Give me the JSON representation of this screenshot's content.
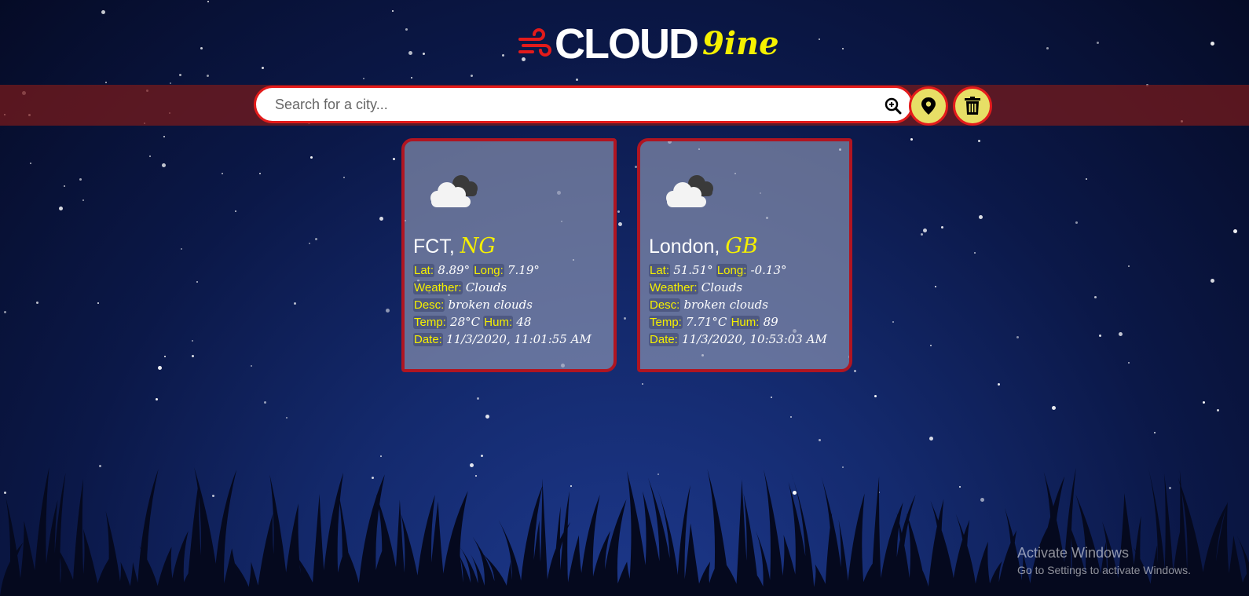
{
  "logo": {
    "word1": "CLOUD",
    "word2": "9ine",
    "icon": "wind-icon"
  },
  "search": {
    "placeholder": "Search for a city...",
    "button_icon": "search-zoom-icon"
  },
  "actions": {
    "location_icon": "map-marker-icon",
    "delete_icon": "trash-icon"
  },
  "cards": [
    {
      "city": "FCT,",
      "country": "NG",
      "icon": "broken-clouds-icon",
      "lat_label": "Lat:",
      "lat": "8.89°",
      "long_label": "Long:",
      "long": "7.19°",
      "weather_label": "Weather:",
      "weather": "Clouds",
      "desc_label": "Desc:",
      "desc": "broken clouds",
      "temp_label": "Temp:",
      "temp": "28°C",
      "hum_label": "Hum:",
      "hum": "48",
      "date_label": "Date:",
      "date": "11/3/2020, 11:01:55 AM"
    },
    {
      "city": "London,",
      "country": "GB",
      "icon": "broken-clouds-icon",
      "lat_label": "Lat:",
      "lat": "51.51°",
      "long_label": "Long:",
      "long": "-0.13°",
      "weather_label": "Weather:",
      "weather": "Clouds",
      "desc_label": "Desc:",
      "desc": "broken clouds",
      "temp_label": "Temp:",
      "temp": "7.71°C",
      "hum_label": "Hum:",
      "hum": "89",
      "date_label": "Date:",
      "date": "11/3/2020, 10:53:03 AM"
    }
  ],
  "watermark": {
    "title": "Activate Windows",
    "subtitle": "Go to Settings to activate Windows."
  },
  "colors": {
    "accent": "#e31b1b",
    "highlight": "#f5f000",
    "button": "#e7df66",
    "card_border": "#b01521"
  }
}
